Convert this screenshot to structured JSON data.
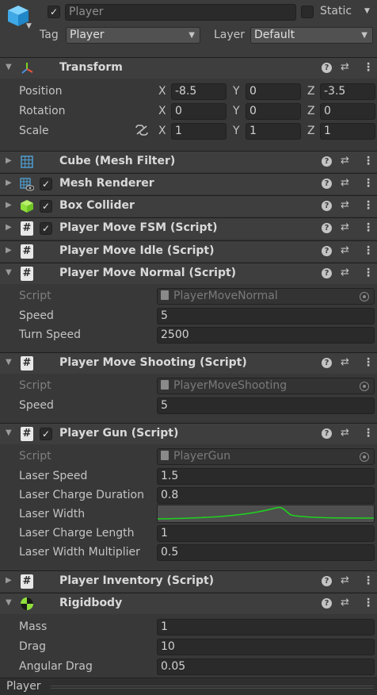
{
  "header": {
    "object_name": "Player",
    "active": true,
    "static_label": "Static",
    "static_checked": false,
    "tag_label": "Tag",
    "tag_value": "Player",
    "layer_label": "Layer",
    "layer_value": "Default"
  },
  "transform": {
    "title": "Transform",
    "rows": [
      {
        "label": "Position",
        "x": "-8.5",
        "y": "0",
        "z": "-3.5"
      },
      {
        "label": "Rotation",
        "x": "0",
        "y": "0",
        "z": "0"
      },
      {
        "label": "Scale",
        "x": "1",
        "y": "1",
        "z": "1"
      }
    ],
    "axis": {
      "x": "X",
      "y": "Y",
      "z": "Z"
    }
  },
  "components": {
    "cube": "Cube (Mesh Filter)",
    "mesh_renderer": "Mesh Renderer",
    "box_collider": "Box Collider",
    "fsm": "Player Move FSM (Script)",
    "idle": "Player Move Idle (Script)",
    "normal": "Player Move Normal (Script)",
    "shooting": "Player Move Shooting (Script)",
    "gun": "Player Gun (Script)",
    "inventory": "Player Inventory (Script)",
    "rigidbody": "Rigidbody"
  },
  "normal": {
    "script_label": "Script",
    "script_value": "PlayerMoveNormal",
    "speed_label": "Speed",
    "speed_value": "5",
    "turn_label": "Turn Speed",
    "turn_value": "2500"
  },
  "shooting": {
    "script_label": "Script",
    "script_value": "PlayerMoveShooting",
    "speed_label": "Speed",
    "speed_value": "5"
  },
  "gun": {
    "script_label": "Script",
    "script_value": "PlayerGun",
    "laser_speed_label": "Laser Speed",
    "laser_speed_value": "1.5",
    "charge_duration_label": "Laser Charge Duration",
    "charge_duration_value": "0.8",
    "laser_width_label": "Laser Width",
    "charge_length_label": "Laser Charge Length",
    "charge_length_value": "1",
    "width_mult_label": "Laser Width Multiplier",
    "width_mult_value": "0.5"
  },
  "rigidbody": {
    "mass_label": "Mass",
    "mass_value": "1",
    "drag_label": "Drag",
    "drag_value": "10",
    "angular_label": "Angular Drag",
    "angular_value": "0.05"
  },
  "footer": {
    "title": "Player"
  },
  "icons": {
    "help": "?",
    "presets": "⇄",
    "kebab": "⋮",
    "fold_open": "▼",
    "fold_closed": "▶",
    "check": "✓",
    "script": "#"
  },
  "colors": {
    "background": "#383838",
    "curve": "#1fd21f",
    "collider": "#8fe03a"
  }
}
